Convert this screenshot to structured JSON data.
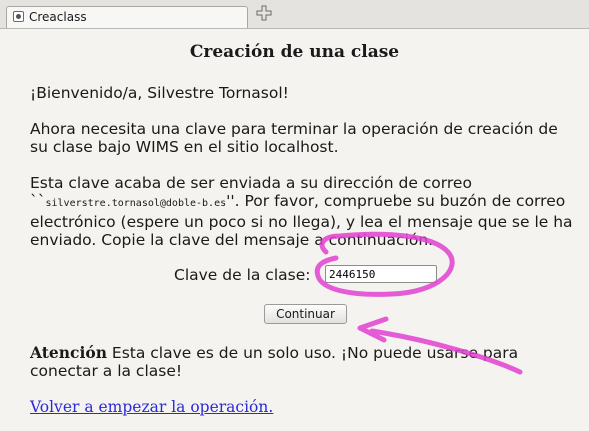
{
  "tab": {
    "title": "Creaclass",
    "icon": "page-icon"
  },
  "new_tab_icon": "new-tab-icon",
  "page": {
    "heading": "Creación de una clase",
    "welcome": "¡Bienvenido/a, Silvestre Tornasol!",
    "need_key": "Ahora necesita una clave para terminar la operación de creación de su clase bajo WIMS en el sitio localhost.",
    "sent_pre": "Esta clave acaba de ser enviada a su dirección de correo ``",
    "email": "silverstre.tornasol@doble-b.es",
    "sent_post": "''. Por favor, compruebe su buzón de correo electrónico (espere un poco si no llega), y lea el mensaje que se le ha enviado. Copie la clave del mensaje a continuación.",
    "key_label": "Clave de la clase:",
    "key_value": "2446150",
    "continue_label": "Continuar",
    "warning_bold": "Atención",
    "warning_text": " Esta clave es de un solo uso. ¡No puede usarse para conectar a la clase!",
    "restart_link": "Volver a empezar la operación."
  },
  "annotation_color": "#e040d0"
}
